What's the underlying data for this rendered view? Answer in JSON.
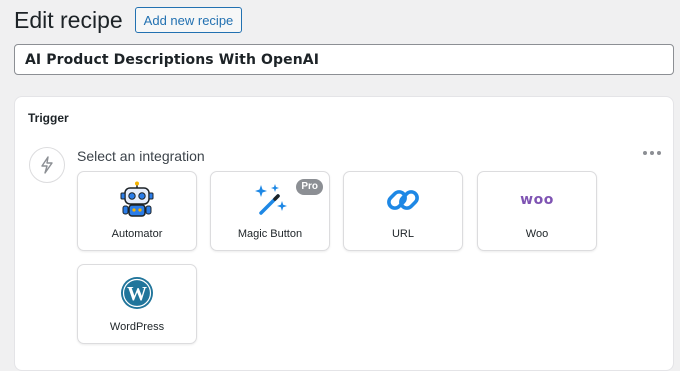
{
  "header": {
    "title": "Edit recipe",
    "add_new_label": "Add new recipe"
  },
  "recipe": {
    "title": "AI Product Descriptions With OpenAI"
  },
  "trigger": {
    "heading": "Trigger",
    "select_label": "Select an integration",
    "integrations": [
      {
        "label": "Automator",
        "icon": "robot-icon"
      },
      {
        "label": "Magic Button",
        "icon": "magic-wand-icon",
        "badge": "Pro"
      },
      {
        "label": "URL",
        "icon": "link-icon"
      },
      {
        "label": "Woo",
        "icon": "woo-logo",
        "logo_text": "woo"
      },
      {
        "label": "WordPress",
        "icon": "wordpress-icon"
      }
    ]
  },
  "colors": {
    "accent": "#2271b1",
    "woo": "#7f54b3",
    "link_blue": "#1e88e5",
    "wordpress_blue": "#21759b"
  }
}
